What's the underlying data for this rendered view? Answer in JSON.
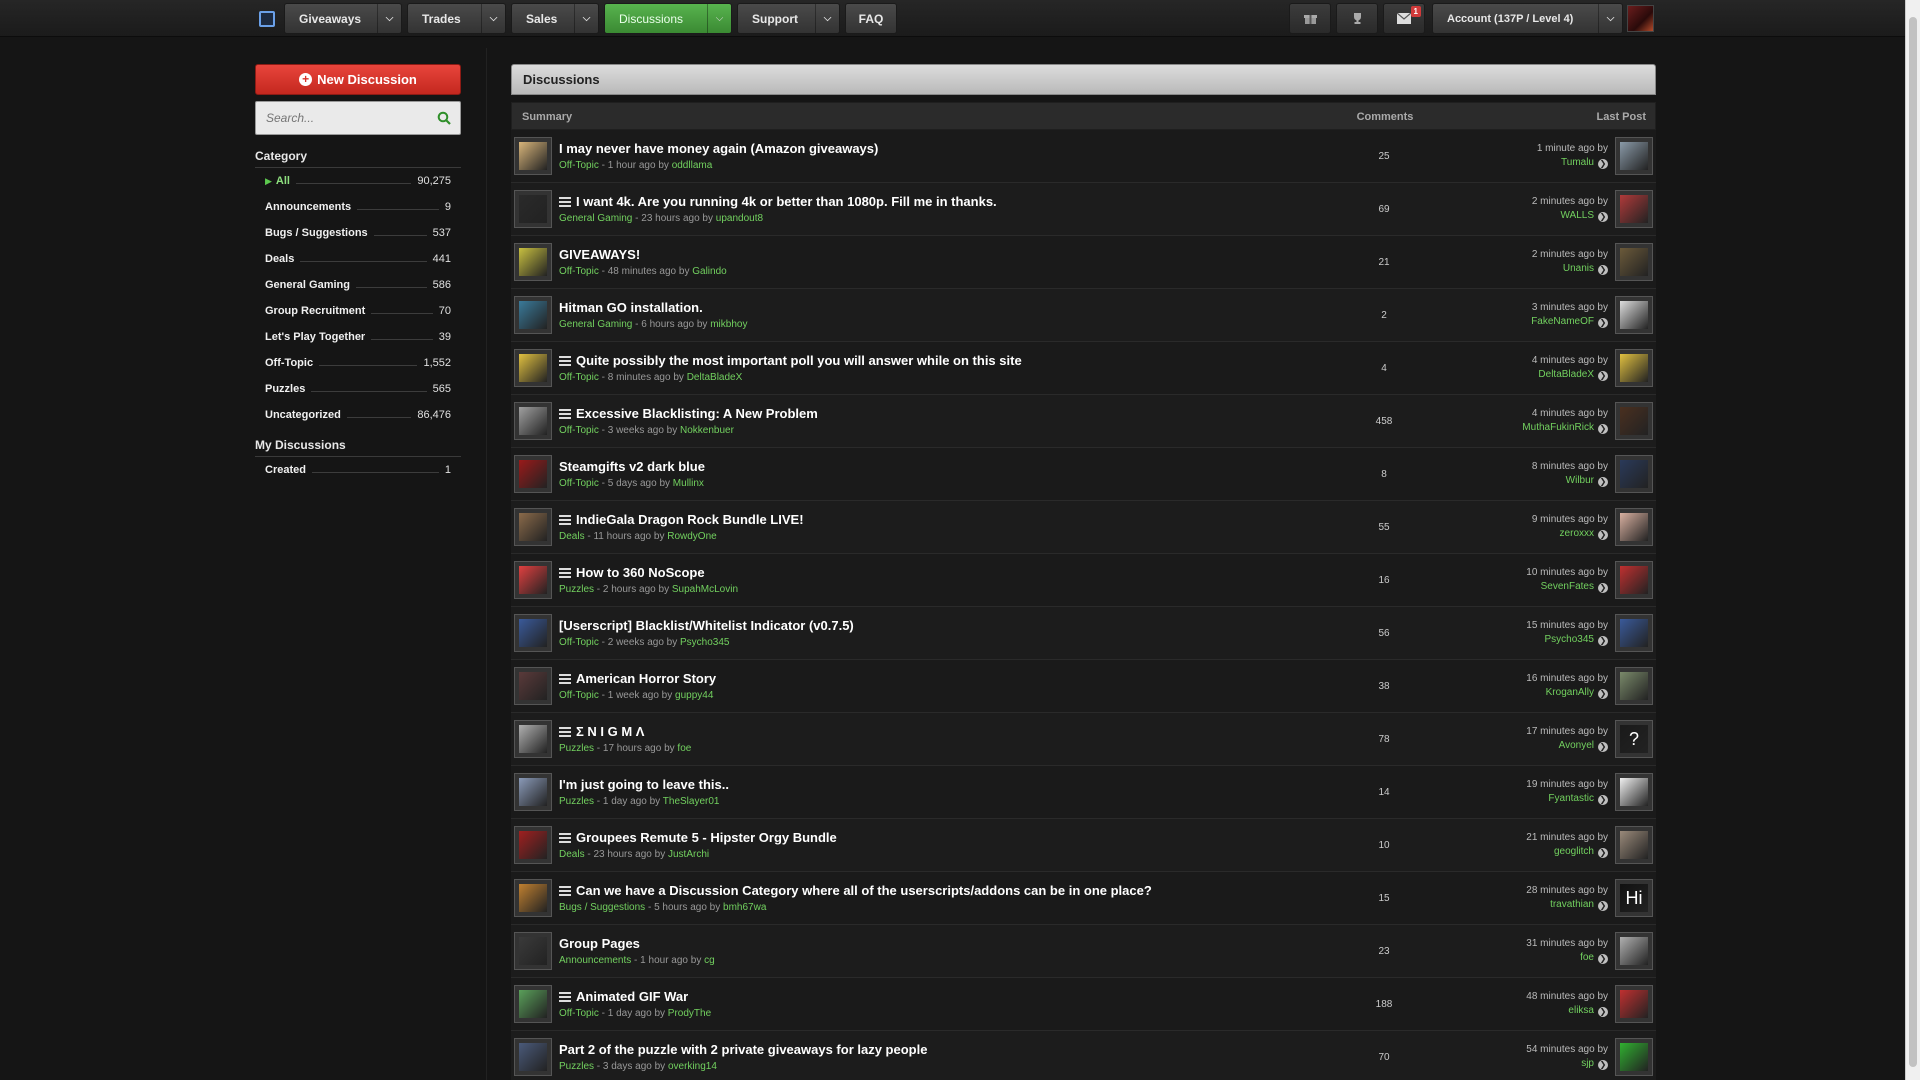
{
  "nav": {
    "items": [
      {
        "label": "Giveaways",
        "dropdown": true
      },
      {
        "label": "Trades",
        "dropdown": true
      },
      {
        "label": "Sales",
        "dropdown": true
      },
      {
        "label": "Discussions",
        "dropdown": true,
        "active": true
      },
      {
        "label": "Support",
        "dropdown": true
      },
      {
        "label": "FAQ",
        "dropdown": false
      }
    ],
    "icons": [
      "gift-icon",
      "trophy-icon",
      "mail-icon"
    ],
    "mail_badge": "1",
    "account": "Account (137P / Level 4)"
  },
  "sidebar": {
    "new_discussion": "New Discussion",
    "search_placeholder": "Search...",
    "category_title": "Category",
    "categories": [
      {
        "name": "All",
        "count": "90,275",
        "active": true
      },
      {
        "name": "Announcements",
        "count": "9"
      },
      {
        "name": "Bugs / Suggestions",
        "count": "537"
      },
      {
        "name": "Deals",
        "count": "441"
      },
      {
        "name": "General Gaming",
        "count": "586"
      },
      {
        "name": "Group Recruitment",
        "count": "70"
      },
      {
        "name": "Let's Play Together",
        "count": "39"
      },
      {
        "name": "Off-Topic",
        "count": "1,552"
      },
      {
        "name": "Puzzles",
        "count": "565"
      },
      {
        "name": "Uncategorized",
        "count": "86,476"
      }
    ],
    "my_title": "My Discussions",
    "my_items": [
      {
        "name": "Created",
        "count": "1"
      }
    ]
  },
  "main": {
    "title": "Discussions",
    "col_summary": "Summary",
    "col_comments": "Comments",
    "col_lastpost": "Last Post",
    "rows": [
      {
        "title": "I may never have money again (Amazon giveaways)",
        "poll": false,
        "category": "Off-Topic",
        "age": "1 hour ago",
        "author": "oddllama",
        "comments": "25",
        "last_time": "1 minute ago by",
        "last_user": "Tumalu",
        "thumb": "#d8b57a",
        "lthumb": "#8a9aa8"
      },
      {
        "title": "I want 4k. Are you running 4k or better than 1080p. Fill me in thanks.",
        "poll": true,
        "category": "General Gaming",
        "age": "23 hours ago",
        "author": "upandout8",
        "comments": "69",
        "last_time": "2 minutes ago by",
        "last_user": "WALLS",
        "thumb": "#2a2a2a",
        "lthumb": "#b03a3a"
      },
      {
        "title": "GIVEAWAYS!",
        "poll": false,
        "category": "Off-Topic",
        "age": "48 minutes ago",
        "author": "Galindo",
        "comments": "21",
        "last_time": "2 minutes ago by",
        "last_user": "Unanis",
        "thumb": "#c8c040",
        "lthumb": "#6b5a3a"
      },
      {
        "title": "Hitman GO installation.",
        "poll": false,
        "category": "General Gaming",
        "age": "6 hours ago",
        "author": "mikbhoy",
        "comments": "2",
        "last_time": "3 minutes ago by",
        "last_user": "FakeNameOF",
        "thumb": "#3a7a9a",
        "lthumb": "#dddddd"
      },
      {
        "title": "Quite possibly the most important poll you will answer while on this site",
        "poll": true,
        "category": "Off-Topic",
        "age": "8 minutes ago",
        "author": "DeltaBladeX",
        "comments": "4",
        "last_time": "4 minutes ago by",
        "last_user": "DeltaBladeX",
        "thumb": "#e0c040",
        "lthumb": "#e0c040"
      },
      {
        "title": "Excessive Blacklisting: A New Problem",
        "poll": true,
        "category": "Off-Topic",
        "age": "3 weeks ago",
        "author": "Nokkenbuer",
        "comments": "458",
        "last_time": "4 minutes ago by",
        "last_user": "MuthaFukinRick",
        "thumb": "#a0a0a0",
        "lthumb": "#4a3020"
      },
      {
        "title": "Steamgifts v2 dark blue",
        "poll": false,
        "category": "Off-Topic",
        "age": "5 days ago",
        "author": "Mullinx",
        "comments": "8",
        "last_time": "8 minutes ago by",
        "last_user": "Wilbur",
        "thumb": "#9a1a1a",
        "lthumb": "#2a3a5a"
      },
      {
        "title": "IndieGala Dragon Rock Bundle LIVE!",
        "poll": true,
        "category": "Deals",
        "age": "11 hours ago",
        "author": "RowdyOne",
        "comments": "55",
        "last_time": "9 minutes ago by",
        "last_user": "zeroxxx",
        "thumb": "#8a6a4a",
        "lthumb": "#d8b0a0"
      },
      {
        "title": "How to 360 NoScope",
        "poll": true,
        "category": "Puzzles",
        "age": "2 hours ago",
        "author": "SupahMcLovin",
        "comments": "16",
        "last_time": "10 minutes ago by",
        "last_user": "SevenFates",
        "thumb": "#e04040",
        "lthumb": "#c03030"
      },
      {
        "title": "[Userscript] Blacklist/Whitelist Indicator (v0.7.5)",
        "poll": false,
        "category": "Off-Topic",
        "age": "2 weeks ago",
        "author": "Psycho345",
        "comments": "56",
        "last_time": "15 minutes ago by",
        "last_user": "Psycho345",
        "thumb": "#3a5a9a",
        "lthumb": "#3a5a9a"
      },
      {
        "title": "American Horror Story",
        "poll": true,
        "category": "Off-Topic",
        "age": "1 week ago",
        "author": "guppy44",
        "comments": "38",
        "last_time": "16 minutes ago by",
        "last_user": "KroganAlly",
        "thumb": "#5a3a3a",
        "lthumb": "#7a8a6a"
      },
      {
        "title": "Σ N I G M Λ",
        "poll": true,
        "category": "Puzzles",
        "age": "17 hours ago",
        "author": "foe",
        "comments": "78",
        "last_time": "17 minutes ago by",
        "last_user": "Avonyel",
        "thumb": "#b0b0b0",
        "lthumb": "#1a1a1a"
      },
      {
        "title": "I'm just going to leave this..",
        "poll": false,
        "category": "Puzzles",
        "age": "1 day ago",
        "author": "TheSlayer01",
        "comments": "14",
        "last_time": "19 minutes ago by",
        "last_user": "Fyantastic",
        "thumb": "#8a9ab8",
        "lthumb": "#f0f0f0"
      },
      {
        "title": "Groupees Remute 5 - Hipster Orgy Bundle",
        "poll": true,
        "category": "Deals",
        "age": "23 hours ago",
        "author": "JustArchi",
        "comments": "10",
        "last_time": "21 minutes ago by",
        "last_user": "geoglitch",
        "thumb": "#a02020",
        "lthumb": "#9a8a7a"
      },
      {
        "title": "Can we have a Discussion Category where all of the userscripts/addons can be in one place?",
        "poll": true,
        "category": "Bugs / Suggestions",
        "age": "5 hours ago",
        "author": "bmh67wa",
        "comments": "15",
        "last_time": "28 minutes ago by",
        "last_user": "travathian",
        "thumb": "#c08030",
        "lthumb": "#111111"
      },
      {
        "title": "Group Pages",
        "poll": false,
        "category": "Announcements",
        "age": "1 hour ago",
        "author": "cg",
        "comments": "23",
        "last_time": "31 minutes ago by",
        "last_user": "foe",
        "thumb": "#3a3a3a",
        "lthumb": "#b0b0b0"
      },
      {
        "title": "Animated GIF War",
        "poll": true,
        "category": "Off-Topic",
        "age": "1 day ago",
        "author": "ProdyThe",
        "comments": "188",
        "last_time": "48 minutes ago by",
        "last_user": "eliksa",
        "thumb": "#5aa05a",
        "lthumb": "#c03030"
      },
      {
        "title": "Part 2 of the puzzle with 2 private giveaways for lazy people",
        "poll": false,
        "category": "Puzzles",
        "age": "3 days ago",
        "author": "overking14",
        "comments": "70",
        "last_time": "54 minutes ago by",
        "last_user": "sjp",
        "thumb": "#4a5a7a",
        "lthumb": "#30b030"
      }
    ]
  },
  "special_thumb_text": {
    "hi": "Hi",
    "question": "?"
  }
}
